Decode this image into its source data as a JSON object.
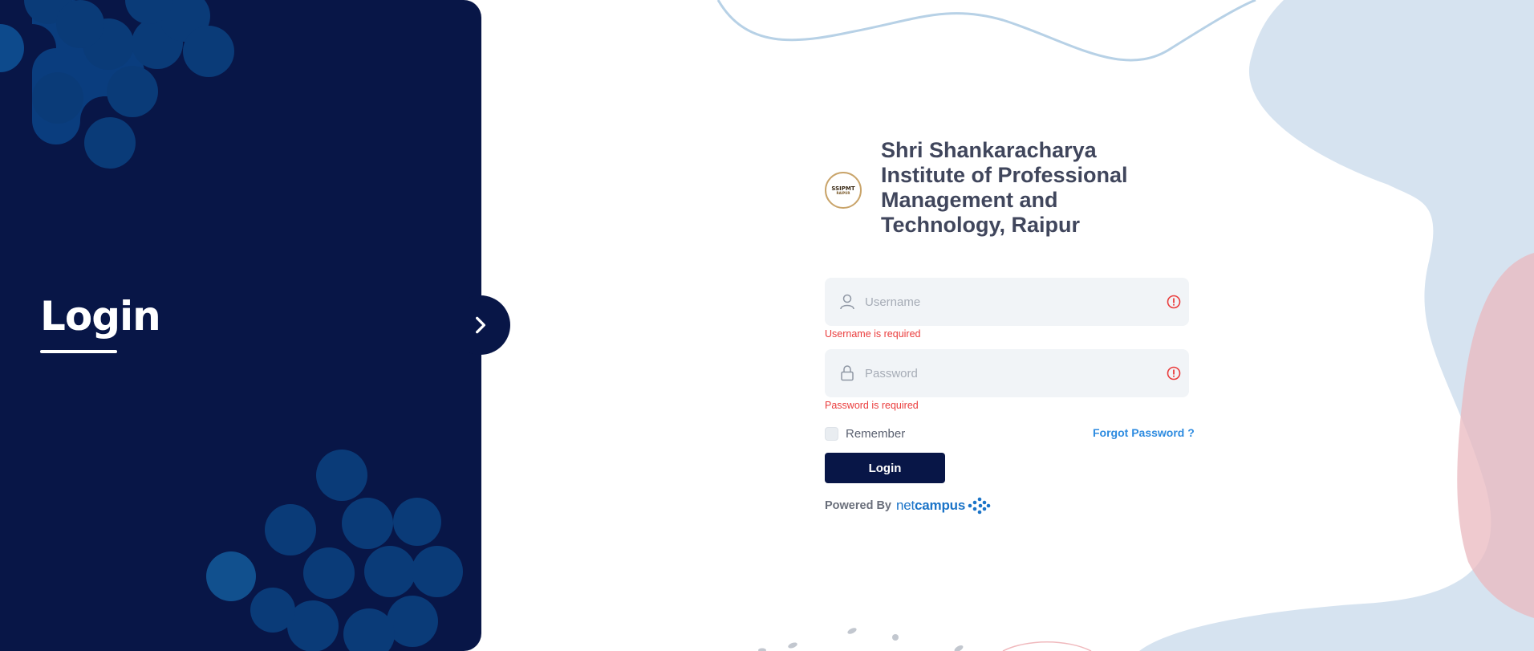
{
  "left_panel": {
    "title": "Login",
    "toggle_icon": "chevron-right-icon"
  },
  "brand": {
    "name": "Shri Shankaracharya Institute of Professional Management and Technology, Raipur",
    "logo_text": "SSIPMT",
    "logo_subtext": "RAIPUR"
  },
  "form": {
    "username": {
      "placeholder": "Username",
      "value": "",
      "error": "Username is required"
    },
    "password": {
      "placeholder": "Password",
      "value": "",
      "error": "Password is required"
    },
    "remember_label": "Remember",
    "forgot_label": "Forgot Password ?",
    "submit_label": "Login"
  },
  "footer": {
    "powered_by": "Powered By",
    "brand_light": "net",
    "brand_bold": "campus"
  },
  "colors": {
    "navy": "#081647",
    "accent_blue": "#2d8be0",
    "error_red": "#ea3c3c"
  }
}
